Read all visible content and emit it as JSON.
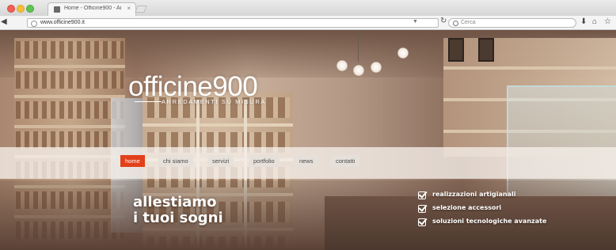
{
  "browser": {
    "tab_title": "Home - Officine900 - Arr...",
    "tab_close": "×",
    "url": "www.officine900.it",
    "search_placeholder": "Cerca",
    "traffic_colors": [
      "#f0605a",
      "#f6bd3b",
      "#5fc453"
    ],
    "icons": [
      "back-arrow-icon",
      "globe-icon",
      "reload-icon",
      "search-icon",
      "download-icon",
      "home-icon",
      "star-icon"
    ]
  },
  "site": {
    "logo": "officine900",
    "tagline": "ARREDAMENTI SU MISURA",
    "nav": [
      {
        "label": "home",
        "active": true
      },
      {
        "label": "chi siamo",
        "active": false
      },
      {
        "label": "servizi",
        "active": false
      },
      {
        "label": "portfolio",
        "active": false
      },
      {
        "label": "news",
        "active": false
      },
      {
        "label": "contatti",
        "active": false
      }
    ],
    "hero": {
      "line1": "allestiamo",
      "line2": "i tuoi sogni"
    },
    "features": [
      "realizzazioni artigianali",
      "selezione accessori",
      "soluzioni tecnologiche avanzate"
    ],
    "accent_color": "#e2401b"
  }
}
